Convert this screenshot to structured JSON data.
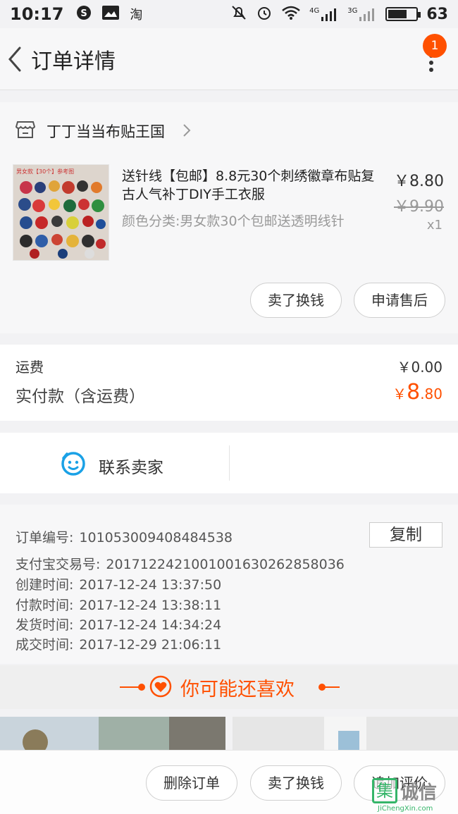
{
  "status_bar": {
    "time": "10:17",
    "notification_icons": [
      "s-icon",
      "image-icon",
      "taobao-icon"
    ],
    "notification_taobao": "淘",
    "network_4g": "4G",
    "network_3g": "3G",
    "battery_level": "63"
  },
  "header": {
    "title": "订单详情",
    "badge_count": "1"
  },
  "shop": {
    "name": "丁丁当当布贴王国"
  },
  "item": {
    "title": "送针线【包邮】8.8元30个刺绣徽章布贴复古人气补丁DIY手工衣服",
    "spec": "颜色分类:男女款30个包邮送透明线针",
    "price": "￥8.80",
    "original_price": "￥9.90",
    "quantity": "x1",
    "thumb_caption": "男女款【30个】参考图"
  },
  "item_actions": {
    "sell_label": "卖了换钱",
    "after_sale_label": "申请售后"
  },
  "fees": {
    "shipping_label": "运费",
    "shipping_value": "￥0.00",
    "paid_label": "实付款（含运费）",
    "paid_currency": "￥",
    "paid_int": "8",
    "paid_dec": ".80"
  },
  "contact": {
    "label": "联系卖家"
  },
  "order_info": {
    "order_no_label": "订单编号:",
    "order_no": "101053009408484538",
    "copy_label": "复制",
    "alipay_label": "支付宝交易号:",
    "alipay_no": "2017122421001001630262858036",
    "created_label": "创建时间:",
    "created": "2017-12-24 13:37:50",
    "paid_label": "付款时间:",
    "paid": "2017-12-24 13:38:11",
    "shipped_label": "发货时间:",
    "shipped": "2017-12-24 14:34:24",
    "closed_label": "成交时间:",
    "closed": "2017-12-29 21:06:11"
  },
  "recommend": {
    "title": "你可能还喜欢"
  },
  "bottom_bar": {
    "delete_label": "删除订单",
    "sell_label": "卖了换钱",
    "review_label": "追加评价"
  },
  "watermark": {
    "char": "集",
    "text": "诚信",
    "url": "JiChengXin.com"
  },
  "colors": {
    "accent": "#ff5000",
    "contact_icon": "#1aa1e6",
    "watermark": "#35b569"
  }
}
